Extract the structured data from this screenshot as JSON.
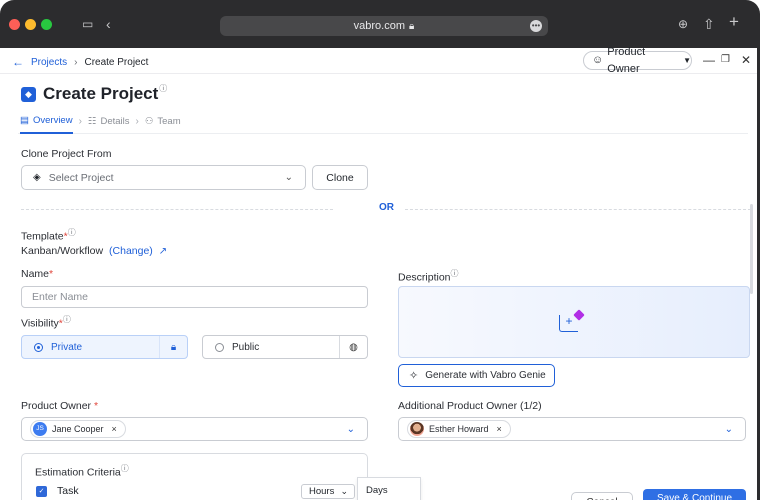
{
  "browser": {
    "url": "vabro.com",
    "colors": {
      "close": "#fe5f57",
      "minimize": "#febc2e",
      "maximize": "#28c840"
    }
  },
  "header": {
    "breadcrumb": {
      "root": "Projects",
      "current": "Create Project"
    },
    "role": "Product Owner"
  },
  "page": {
    "title": "Create Project",
    "tabs": [
      {
        "label": "Overview",
        "active": true
      },
      {
        "label": "Details",
        "active": false
      },
      {
        "label": "Team",
        "active": false
      }
    ]
  },
  "clone": {
    "label": "Clone Project From",
    "placeholder": "Select Project",
    "button": "Clone"
  },
  "divider": {
    "text": "OR"
  },
  "template": {
    "label": "Template",
    "required_mark": "*",
    "value": "Kanban/Workflow",
    "change_link": "(Change)"
  },
  "name": {
    "label": "Name",
    "required_mark": "*",
    "placeholder": "Enter Name"
  },
  "description": {
    "label": "Description",
    "genie_button": "Generate with Vabro Genie"
  },
  "visibility": {
    "label": "Visibility",
    "required_mark": "*",
    "options": [
      {
        "label": "Private",
        "selected": true
      },
      {
        "label": "Public",
        "selected": false
      }
    ]
  },
  "product_owner": {
    "label": "Product Owner",
    "required_mark": "*",
    "chip": {
      "initials": "JS",
      "name": "Jane Cooper"
    }
  },
  "additional_owner": {
    "label": "Additional Product Owner (1/2)",
    "chip": {
      "name": "Esther Howard"
    }
  },
  "estimation": {
    "label": "Estimation Criteria",
    "rows": [
      {
        "name": "Task",
        "unit": "Hours"
      }
    ],
    "dropdown_option": "Days"
  },
  "footer": {
    "cancel": "Cancel",
    "save": "Save & Continue"
  },
  "accent_color": "#2060d8"
}
